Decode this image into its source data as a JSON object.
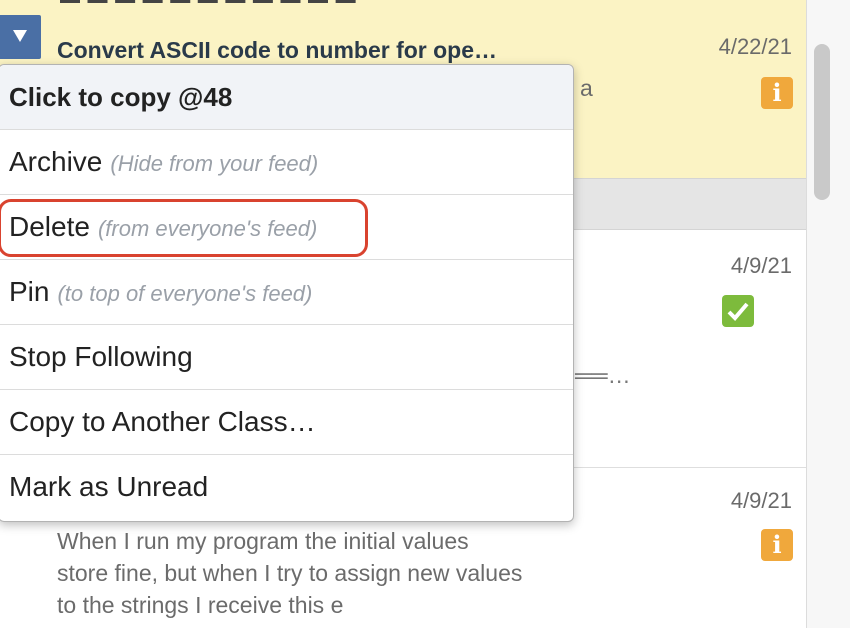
{
  "feed": {
    "items": [
      {
        "title": "Convert ASCII code to number for ope…",
        "snippet": "r a",
        "date": "4/22/21",
        "badge": "info-icon"
      },
      {
        "snippet": "══…",
        "date": "4/9/21",
        "badge": "check-icon"
      },
      {
        "snippet_lines": [
          "When I run my program the initial values",
          "store fine, but when I try to assign new values",
          "to the strings I receive this e"
        ],
        "date": "4/9/21",
        "badge": "info-icon"
      }
    ],
    "badge_letter": "i"
  },
  "menu": {
    "header": "Click to copy @48",
    "items": [
      {
        "label": "Archive",
        "hint": "(Hide from your feed)"
      },
      {
        "label": "Delete",
        "hint": "(from everyone's feed)"
      },
      {
        "label": "Pin",
        "hint": "(to top of everyone's feed)"
      },
      {
        "label": "Stop Following",
        "hint": ""
      },
      {
        "label": "Copy to Another Class…",
        "hint": ""
      },
      {
        "label": "Mark as Unread",
        "hint": ""
      }
    ]
  },
  "colors": {
    "active_item_bg": "#fbf3c4",
    "highlight": "#d9432f",
    "info_badge": "#f0a83c",
    "check_badge": "#7dbb3c",
    "toggle": "#4a6fa5"
  }
}
